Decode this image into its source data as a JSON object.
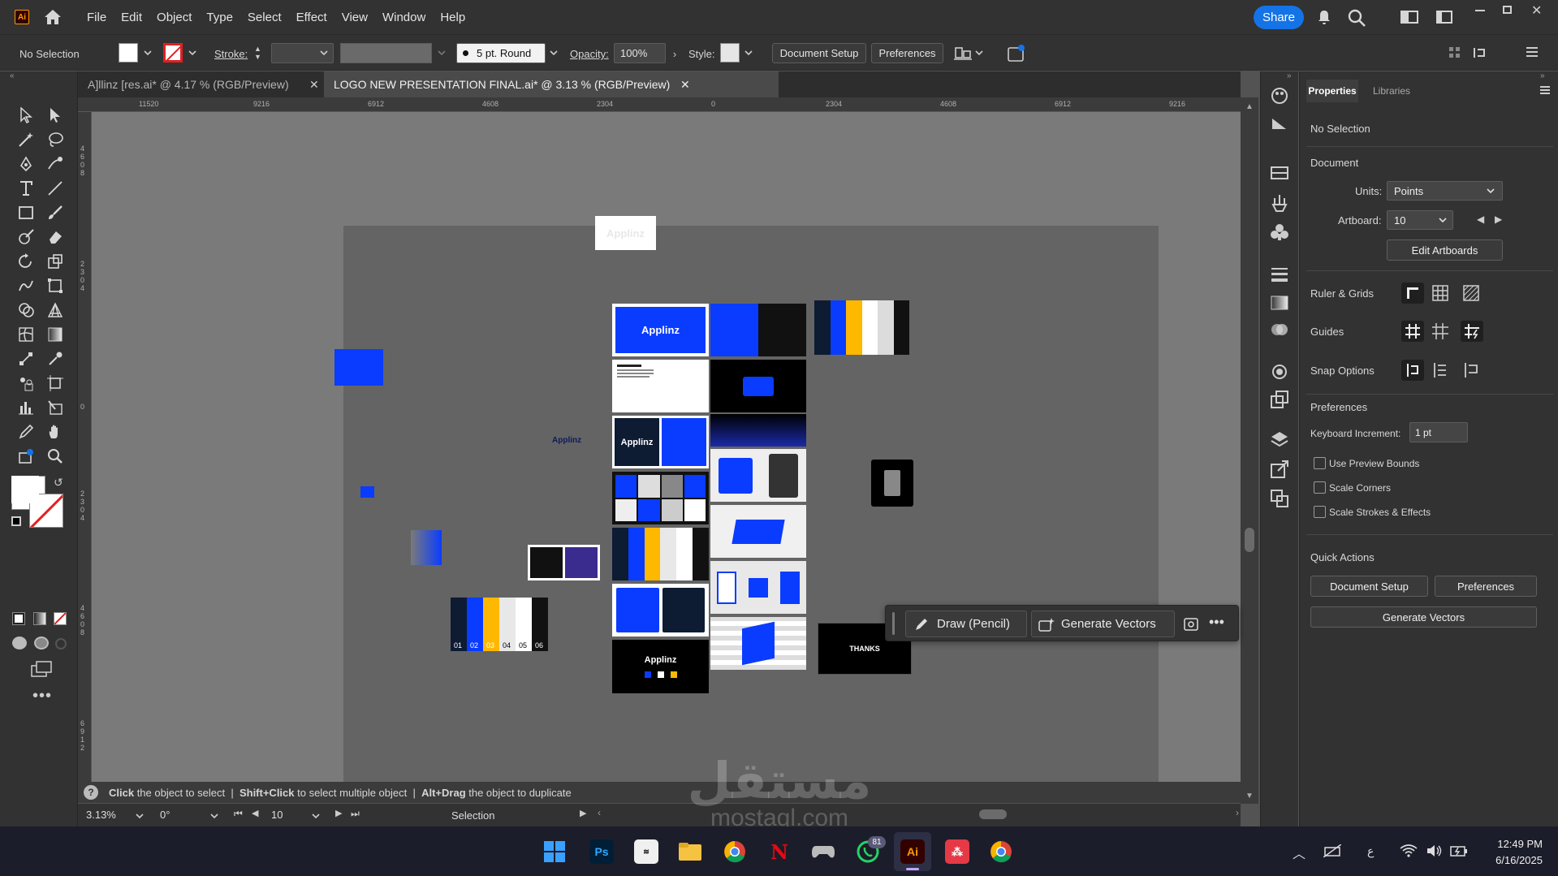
{
  "app": {
    "logo_text": "Ai"
  },
  "menu": [
    "File",
    "Edit",
    "Object",
    "Type",
    "Select",
    "Effect",
    "View",
    "Window",
    "Help"
  ],
  "share_label": "Share",
  "control_bar": {
    "selection": "No Selection",
    "stroke_label": "Stroke:",
    "brush": "5 pt. Round",
    "opacity_label": "Opacity:",
    "opacity_value": "100%",
    "style_label": "Style:",
    "document_setup": "Document Setup",
    "preferences": "Preferences"
  },
  "tabs": [
    {
      "label": "A]llinz [res.ai* @ 4.17 % (RGB/Preview)",
      "active": false
    },
    {
      "label": "LOGO NEW PRESENTATION FINAL.ai* @ 3.13 % (RGB/Preview)",
      "active": true
    }
  ],
  "ruler_top": [
    "11520",
    "9216",
    "6912",
    "4608",
    "2304",
    "0",
    "2304",
    "4608",
    "6912",
    "9216"
  ],
  "ruler_left_groups": [
    "4608",
    "2304",
    "0",
    "2304",
    "4608",
    "6912"
  ],
  "artwork": {
    "logo_text": "Applinz",
    "slide_numbers": [
      "01",
      "02",
      "03",
      "04",
      "05",
      "06"
    ],
    "thanks": "THANKS"
  },
  "context_bar": {
    "draw": "Draw (Pencil)",
    "generate": "Generate Vectors"
  },
  "properties": {
    "tabs": [
      "Properties",
      "Libraries"
    ],
    "no_selection": "No Selection",
    "document_header": "Document",
    "units_label": "Units:",
    "units_value": "Points",
    "artboard_label": "Artboard:",
    "artboard_value": "10",
    "edit_artboards": "Edit Artboards",
    "ruler_grids": "Ruler & Grids",
    "guides": "Guides",
    "snap_options": "Snap Options",
    "preferences_header": "Preferences",
    "keyboard_increment_label": "Keyboard Increment:",
    "keyboard_increment_value": "1 pt",
    "use_preview_bounds": "Use Preview Bounds",
    "scale_corners": "Scale Corners",
    "scale_strokes": "Scale Strokes & Effects",
    "quick_actions": "Quick Actions",
    "document_setup_btn": "Document Setup",
    "preferences_btn": "Preferences",
    "generate_vectors_btn": "Generate Vectors"
  },
  "hint": {
    "part1_bold": "Click",
    "part1": " the object to select",
    "sep": "|",
    "part2_bold": "Shift+Click",
    "part2": " to select multiple object",
    "part3_bold": "Alt+Drag",
    "part3": " the object to duplicate"
  },
  "status": {
    "zoom": "3.13%",
    "rotation": "0°",
    "artboard": "10",
    "tool": "Selection"
  },
  "watermark": {
    "arabic": "مستقل",
    "latin": "mostaql.com"
  },
  "taskbar": {
    "time": "12:49 PM",
    "date": "6/16/2025",
    "lang": "ع",
    "whatsapp_badge": "81"
  },
  "colors": {
    "brand_blue": "#0a3cff",
    "accent_yellow": "#ffb800",
    "navy": "#0d1b33",
    "adobe_blue": "#1473e6"
  }
}
